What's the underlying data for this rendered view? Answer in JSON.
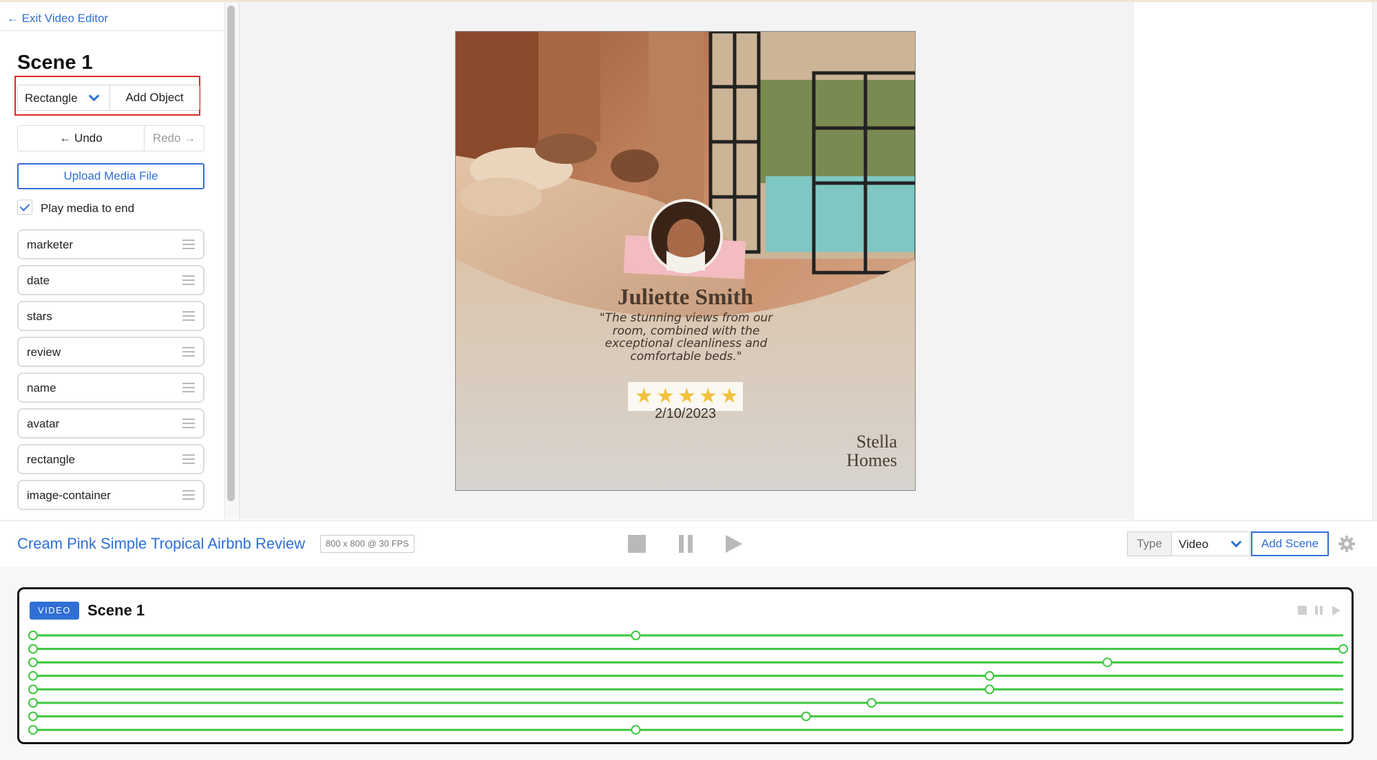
{
  "sidebar": {
    "exit_label": "← Exit Video Editor",
    "scene_title": "Scene 1",
    "object_type": "Rectangle",
    "add_object_label": "Add Object",
    "undo_label": "← Undo",
    "redo_label": "Redo →",
    "upload_label": "Upload Media File",
    "play_to_end_label": "Play media to end",
    "play_to_end_checked": true,
    "layers": [
      "marketer",
      "date",
      "stars",
      "review",
      "name",
      "avatar",
      "rectangle",
      "image-container"
    ]
  },
  "preview": {
    "name": "Juliette Smith",
    "review": "\"The stunning views from our room, combined with the exceptional cleanliness and comfortable beds.\"",
    "rating": 5,
    "date": "2/10/2023",
    "brand_line1": "Stella",
    "brand_line2": "Homes"
  },
  "toolbar": {
    "project_title": "Cream Pink Simple Tropical Airbnb Review",
    "resolution": "800 x 800 @ 30 FPS",
    "type_label": "Type",
    "type_value": "Video",
    "add_scene_label": "Add Scene"
  },
  "timeline": {
    "badge": "VIDEO",
    "scene_title": "Scene 1",
    "track_keyframes": [
      0.46,
      1.0,
      0.82,
      0.73,
      0.73,
      0.64,
      0.59,
      0.46
    ]
  },
  "colors": {
    "accent": "#2f6fd6",
    "highlight": "#e02424",
    "track": "#3cc73c",
    "star": "#f2c23e"
  },
  "icons": {
    "drag": "drag-handle-icon",
    "gear": "gear-icon",
    "chevron": "chevron-down-icon"
  }
}
